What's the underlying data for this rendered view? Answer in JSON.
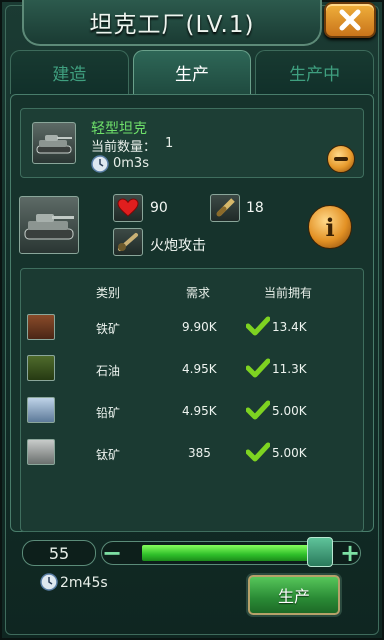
{
  "window": {
    "title": "坦克工厂(LV.1)"
  },
  "tabs": [
    {
      "label": "建造",
      "active": false
    },
    {
      "label": "生产",
      "active": true
    },
    {
      "label": "生产中",
      "active": false
    }
  ],
  "queue": {
    "name": "轻型坦克",
    "qty_label": "当前数量：",
    "qty_value": "1",
    "time": "0m3s",
    "icon": "tank-icon"
  },
  "unit": {
    "health": "90",
    "ammo": "18",
    "attack_type": "火炮攻击",
    "health_icon": "heart-icon",
    "ammo_icon": "shell-icon",
    "attack_icon": "cannon-icon"
  },
  "requirements": {
    "headers": [
      "类别",
      "需求",
      "当前拥有"
    ],
    "rows": [
      {
        "icon": "iron-ore-icon",
        "name": "铁矿",
        "need": "9.90K",
        "have": "13.4K"
      },
      {
        "icon": "oil-icon",
        "name": "石油",
        "need": "4.95K",
        "have": "11.3K"
      },
      {
        "icon": "lead-ore-icon",
        "name": "铅矿",
        "need": "4.95K",
        "have": "5.00K"
      },
      {
        "icon": "titanium-ore-icon",
        "name": "钛矿",
        "need": "385",
        "have": "5.00K"
      }
    ]
  },
  "production": {
    "quantity": "55",
    "slider_fraction": 1.0,
    "time": "2m45s",
    "button_label": "生产"
  },
  "colors": {
    "accent_green": "#6fe06a",
    "check_green": "#7ed321",
    "gold": "#e39124"
  }
}
